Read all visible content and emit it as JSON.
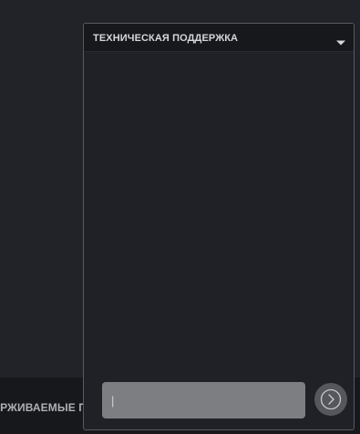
{
  "bottom_bar": {
    "label": "ЕРЖИВАЕМЫЕ П"
  },
  "chat": {
    "title": "ТЕХНИЧЕСКАЯ ПОДДЕРЖКА",
    "collapse_icon": "chevron-down-icon",
    "input": {
      "value": "",
      "placeholder": "|"
    },
    "send_icon": "circle-arrow-right-icon"
  },
  "colors": {
    "background": "#222328",
    "panel": "#202127",
    "header": "#17181c",
    "input": "#7d7e82",
    "send_button": "#55575c"
  }
}
